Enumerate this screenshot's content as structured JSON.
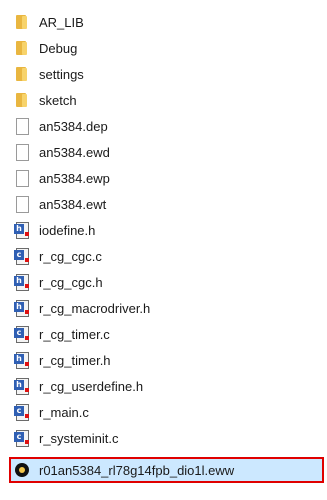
{
  "files": [
    {
      "name": "AR_LIB",
      "icon": "folder-icon"
    },
    {
      "name": "Debug",
      "icon": "folder-icon"
    },
    {
      "name": "settings",
      "icon": "folder-icon"
    },
    {
      "name": "sketch",
      "icon": "folder-icon"
    },
    {
      "name": "an5384.dep",
      "icon": "file-icon"
    },
    {
      "name": "an5384.ewd",
      "icon": "file-icon"
    },
    {
      "name": "an5384.ewp",
      "icon": "file-icon"
    },
    {
      "name": "an5384.ewt",
      "icon": "file-icon"
    },
    {
      "name": "iodefine.h",
      "icon": "source-file-icon"
    },
    {
      "name": "r_cg_cgc.c",
      "icon": "source-file-icon"
    },
    {
      "name": "r_cg_cgc.h",
      "icon": "source-file-icon"
    },
    {
      "name": "r_cg_macrodriver.h",
      "icon": "source-file-icon"
    },
    {
      "name": "r_cg_timer.c",
      "icon": "source-file-icon"
    },
    {
      "name": "r_cg_timer.h",
      "icon": "source-file-icon"
    },
    {
      "name": "r_cg_userdefine.h",
      "icon": "source-file-icon"
    },
    {
      "name": "r_main.c",
      "icon": "source-file-icon"
    },
    {
      "name": "r_systeminit.c",
      "icon": "source-file-icon"
    },
    {
      "name": "r01an5384_rl78g14fpb_dio1l.eww",
      "icon": "workspace-icon",
      "selected": true
    }
  ],
  "colors": {
    "selection_bg": "#cce8ff",
    "selection_outline": "#e00000",
    "folder": "#e9b640"
  }
}
